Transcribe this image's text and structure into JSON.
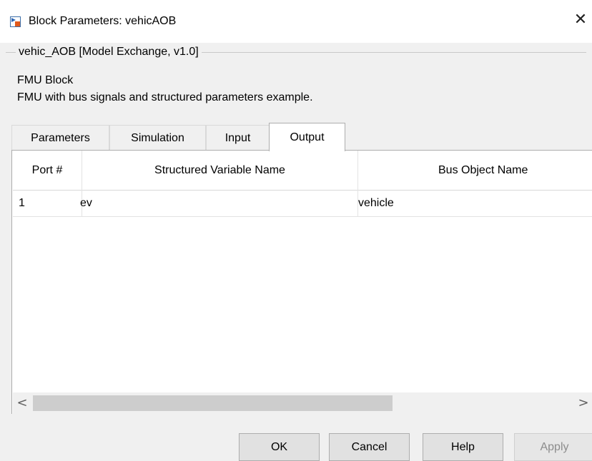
{
  "window": {
    "title": "Block Parameters: vehicAOB",
    "close_glyph": "✕"
  },
  "group": {
    "title": "vehic_AOB [Model Exchange, v1.0]",
    "description_title": "FMU Block",
    "description_text": "FMU with bus signals and structured parameters example."
  },
  "tabs": [
    {
      "label": "Parameters",
      "active": false
    },
    {
      "label": "Simulation",
      "active": false
    },
    {
      "label": "Input",
      "active": false
    },
    {
      "label": "Output",
      "active": true
    }
  ],
  "table": {
    "columns": [
      "Port #",
      "Structured Variable Name",
      "Bus Object Name"
    ],
    "rows": [
      [
        "1",
        "ev",
        "vehicle"
      ]
    ]
  },
  "scrollbar": {
    "left_glyph": "<",
    "right_glyph": ">"
  },
  "buttons": {
    "ok": "OK",
    "cancel": "Cancel",
    "help": "Help",
    "apply": "Apply"
  },
  "icons": {
    "app_icon": "simulink-block-icon",
    "close": "close-icon"
  }
}
